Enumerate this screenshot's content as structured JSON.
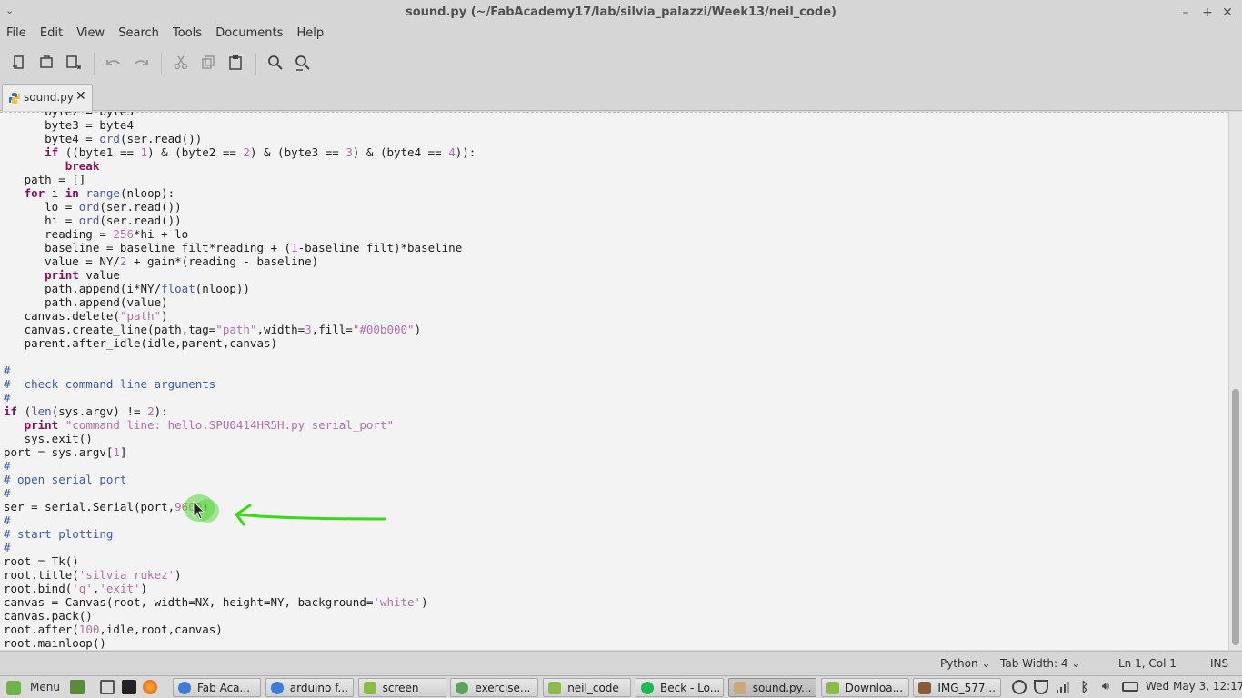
{
  "window": {
    "title": "sound.py (~/FabAcademy17/lab/silvia_palazzi/Week13/neil_code)",
    "minimize": "–",
    "maximize": "+",
    "close": "✕"
  },
  "menubar": [
    "File",
    "Edit",
    "View",
    "Search",
    "Tools",
    "Documents",
    "Help"
  ],
  "toolbar": {
    "icons": [
      "new-document-icon",
      "open-document-icon",
      "save-document-icon",
      "undo-icon",
      "redo-icon",
      "cut-icon",
      "copy-icon",
      "paste-icon",
      "find-icon",
      "find-replace-icon"
    ]
  },
  "tabs": [
    {
      "label": "sound.py",
      "close": "✕",
      "icon": "python-file-icon"
    }
  ],
  "editor": {
    "lines": [
      "      byte2 = byte3",
      "      byte3 = byte4",
      "      byte4 = ord(ser.read())",
      "      if ((byte1 == 1) & (byte2 == 2) & (byte3 == 3) & (byte4 == 4)):",
      "         break",
      "   path = []",
      "   for i in range(nloop):",
      "      lo = ord(ser.read())",
      "      hi = ord(ser.read())",
      "      reading = 256*hi + lo",
      "      baseline = baseline_filt*reading + (1-baseline_filt)*baseline",
      "      value = NY/2 + gain*(reading - baseline)",
      "      print value",
      "      path.append(i*NY/float(nloop))",
      "      path.append(value)",
      "   canvas.delete(\"path\")",
      "   canvas.create_line(path,tag=\"path\",width=3,fill=\"#00b000\")",
      "   parent.after_idle(idle,parent,canvas)",
      "",
      "#",
      "#  check command line arguments",
      "#",
      "if (len(sys.argv) != 2):",
      "   print \"command line: hello.SPU0414HR5H.py serial_port\"",
      "   sys.exit()",
      "port = sys.argv[1]",
      "#",
      "# open serial port",
      "#",
      "ser = serial.Serial(port,9600)",
      "#",
      "# start plotting",
      "#",
      "root = Tk()",
      "root.title('silvia rukez')",
      "root.bind('q','exit')",
      "canvas = Canvas(root, width=NX, height=NY, background='white')",
      "canvas.pack()",
      "root.after(100,idle,root,canvas)",
      "root.mainloop()"
    ],
    "colors": {
      "keyword": "#8a0f5a",
      "builtin": "#4a5aa0",
      "number": "#b271a8",
      "string": "#b271a8",
      "comment": "#3a5ea8",
      "annotation": "#33dd11"
    }
  },
  "statusbar": {
    "language": "Python",
    "tab_width": "Tab Width: 4",
    "position": "Ln 1, Col 1",
    "mode": "INS"
  },
  "taskbar": {
    "menu_label": "Menu",
    "items": [
      {
        "label": "Fab Aca...",
        "icon": "chrome-icon",
        "color": "#3b7dd8"
      },
      {
        "label": "arduino f...",
        "icon": "chrome-icon",
        "color": "#3b7dd8"
      },
      {
        "label": "screen",
        "icon": "folder-icon",
        "color": "#8dbb4b"
      },
      {
        "label": "exercise...",
        "icon": "chrome-app-icon",
        "color": "#5aa55a"
      },
      {
        "label": "neil_code",
        "icon": "folder-icon",
        "color": "#8dbb4b"
      },
      {
        "label": "Beck - Lo...",
        "icon": "spotify-icon",
        "color": "#1db954"
      },
      {
        "label": "sound.py...",
        "icon": "text-editor-icon",
        "color": "#c9a97a"
      },
      {
        "label": "Downloa...",
        "icon": "folder-icon",
        "color": "#8dbb4b"
      },
      {
        "label": "IMG_577...",
        "icon": "image-viewer-icon",
        "color": "#8a5a3a"
      }
    ],
    "clock": "Wed May  3, 12:17"
  }
}
